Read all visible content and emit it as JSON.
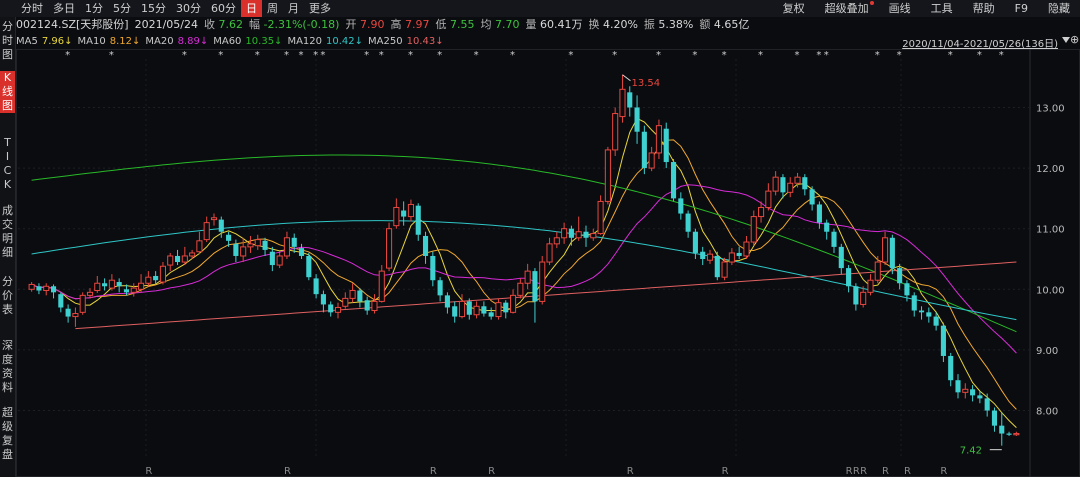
{
  "toolbar": {
    "periods": [
      "分时",
      "多日",
      "1分",
      "5分",
      "15分",
      "30分",
      "60分",
      "日",
      "周",
      "月",
      "更多"
    ],
    "active_period": "日",
    "tools": [
      "复权",
      "超级叠加",
      "画线",
      "工具",
      "帮助",
      "F9",
      "隐藏"
    ]
  },
  "quote": {
    "code": "002124.SZ[天邦股份]",
    "date": "2021/05/24",
    "close_label": "收",
    "close": "7.62",
    "change_label": "幅",
    "change": "-2.31%(-0.18)",
    "open_label": "开",
    "open": "7.90",
    "high_label": "高",
    "high": "7.97",
    "low_label": "低",
    "low": "7.55",
    "avg_label": "均",
    "avg": "7.70",
    "volume_label": "量",
    "volume": "60.41万",
    "turnover_label": "换",
    "turnover": "4.20%",
    "amplitude_label": "振",
    "amplitude": "5.38%",
    "amount_label": "额",
    "amount": "4.65亿"
  },
  "ma": [
    {
      "label": "MA5",
      "value": "7.96↓",
      "color": "#e7d53a"
    },
    {
      "label": "MA10",
      "value": "8.12↓",
      "color": "#f0a830"
    },
    {
      "label": "MA20",
      "value": "8.89↓",
      "color": "#d72bd7"
    },
    {
      "label": "MA60",
      "value": "10.35↓",
      "color": "#28b928"
    },
    {
      "label": "MA120",
      "value": "10.42↓",
      "color": "#2fc6c6"
    },
    {
      "label": "MA250",
      "value": "10.43↓",
      "color": "#e06060"
    }
  ],
  "range_text": "2020/11/04-2021/05/26(136日)",
  "sidebar": [
    {
      "name": "intraday",
      "chars": [
        "分",
        "时",
        "图"
      ],
      "active": false
    },
    {
      "name": "kline",
      "chars": [
        "K",
        "线",
        "图"
      ],
      "active": true
    },
    {
      "name": "tick",
      "chars": [
        "T",
        "I",
        "C",
        "K"
      ],
      "active": false
    },
    {
      "name": "trades",
      "chars": [
        "成",
        "交",
        "明",
        "细"
      ],
      "active": false
    },
    {
      "name": "price-table",
      "chars": [
        "分",
        "价",
        "表"
      ],
      "active": false
    },
    {
      "name": "depth",
      "chars": [
        "深",
        "度",
        "资",
        "料"
      ],
      "active": false
    },
    {
      "name": "super-review",
      "chars": [
        "超",
        "级",
        "复",
        "盘"
      ],
      "active": false
    }
  ],
  "chart_data": {
    "type": "candlestick",
    "ylim": [
      7.2,
      13.8
    ],
    "y_ticks": [
      8.0,
      9.0,
      10.0,
      11.0,
      12.0,
      13.0
    ],
    "y_tick_labels": [
      "8.00",
      "9.00",
      "10.00",
      "11.00",
      "12.00",
      "13.00"
    ],
    "up_color": "#e8473f",
    "down_color": "#3fd0d0",
    "annotations": {
      "high": "13.54",
      "low": "7.42"
    },
    "event_marker": "*",
    "rights_marker": "R",
    "candles": [
      [
        10.0,
        10.08,
        10.12,
        9.96
      ],
      [
        10.05,
        9.98,
        10.1,
        9.92
      ],
      [
        9.98,
        10.05,
        10.1,
        9.9
      ],
      [
        10.05,
        9.95,
        10.08,
        9.85
      ],
      [
        9.92,
        9.7,
        9.95,
        9.62
      ],
      [
        9.68,
        9.55,
        9.75,
        9.45
      ],
      [
        9.55,
        9.6,
        9.7,
        9.38
      ],
      [
        9.62,
        9.9,
        9.95,
        9.58
      ],
      [
        9.9,
        9.95,
        10.02,
        9.85
      ],
      [
        9.98,
        10.1,
        10.22,
        9.94
      ],
      [
        10.1,
        10.05,
        10.18,
        9.98
      ],
      [
        10.02,
        10.15,
        10.25,
        9.98
      ],
      [
        10.12,
        10.05,
        10.18,
        9.95
      ],
      [
        10.0,
        9.95,
        10.08,
        9.9
      ],
      [
        9.95,
        10.02,
        10.1,
        9.88
      ],
      [
        10.0,
        10.1,
        10.25,
        9.95
      ],
      [
        10.1,
        10.2,
        10.3,
        10.05
      ],
      [
        10.22,
        10.15,
        10.3,
        10.08
      ],
      [
        10.12,
        10.38,
        10.45,
        10.08
      ],
      [
        10.4,
        10.55,
        10.6,
        10.3
      ],
      [
        10.55,
        10.45,
        10.65,
        10.4
      ],
      [
        10.45,
        10.55,
        10.7,
        10.4
      ],
      [
        10.55,
        10.6,
        10.65,
        10.5
      ],
      [
        10.62,
        10.8,
        10.95,
        10.58
      ],
      [
        10.82,
        11.1,
        11.2,
        10.78
      ],
      [
        11.15,
        11.18,
        11.25,
        11.05
      ],
      [
        11.15,
        10.95,
        11.2,
        10.85
      ],
      [
        10.9,
        10.8,
        10.95,
        10.7
      ],
      [
        10.75,
        10.55,
        10.82,
        10.45
      ],
      [
        10.55,
        10.7,
        10.85,
        10.45
      ],
      [
        10.7,
        10.75,
        10.88,
        10.6
      ],
      [
        10.72,
        10.82,
        10.9,
        10.65
      ],
      [
        10.8,
        10.65,
        10.85,
        10.55
      ],
      [
        10.62,
        10.4,
        10.7,
        10.3
      ],
      [
        10.4,
        10.55,
        10.62,
        10.35
      ],
      [
        10.55,
        10.85,
        10.95,
        10.5
      ],
      [
        10.85,
        10.7,
        10.92,
        10.6
      ],
      [
        10.68,
        10.55,
        10.75,
        10.5
      ],
      [
        10.55,
        10.2,
        10.6,
        10.15
      ],
      [
        10.18,
        9.92,
        10.25,
        9.85
      ],
      [
        9.92,
        9.75,
        9.98,
        9.62
      ],
      [
        9.75,
        9.62,
        9.8,
        9.55
      ],
      [
        9.62,
        9.7,
        9.78,
        9.52
      ],
      [
        9.72,
        9.85,
        9.95,
        9.68
      ],
      [
        9.85,
        9.98,
        10.1,
        9.78
      ],
      [
        9.98,
        9.8,
        10.02,
        9.7
      ],
      [
        9.82,
        9.65,
        9.88,
        9.58
      ],
      [
        9.65,
        9.8,
        9.92,
        9.6
      ],
      [
        9.8,
        10.3,
        10.4,
        9.78
      ],
      [
        10.35,
        11.0,
        11.1,
        10.3
      ],
      [
        11.05,
        11.35,
        11.5,
        11.0
      ],
      [
        11.3,
        11.2,
        11.45,
        11.05
      ],
      [
        11.2,
        11.4,
        11.48,
        11.12
      ],
      [
        11.38,
        10.9,
        11.42,
        10.8
      ],
      [
        10.88,
        10.55,
        10.95,
        10.42
      ],
      [
        10.55,
        10.15,
        10.62,
        10.05
      ],
      [
        10.15,
        9.9,
        10.2,
        9.8
      ],
      [
        9.9,
        9.7,
        9.95,
        9.6
      ],
      [
        9.72,
        9.55,
        9.8,
        9.45
      ],
      [
        9.55,
        9.8,
        9.92,
        9.52
      ],
      [
        9.8,
        9.58,
        9.85,
        9.5
      ],
      [
        9.58,
        9.72,
        9.8,
        9.52
      ],
      [
        9.72,
        9.6,
        9.8,
        9.55
      ],
      [
        9.62,
        9.55,
        9.7,
        9.5
      ],
      [
        9.55,
        9.78,
        9.85,
        9.5
      ],
      [
        9.78,
        9.62,
        9.82,
        9.52
      ],
      [
        9.62,
        9.9,
        10.0,
        9.6
      ],
      [
        9.9,
        10.1,
        10.18,
        9.85
      ],
      [
        10.1,
        10.3,
        10.42,
        10.0
      ],
      [
        10.3,
        9.8,
        10.35,
        9.45
      ],
      [
        9.8,
        10.45,
        10.55,
        9.75
      ],
      [
        10.45,
        10.75,
        10.85,
        10.4
      ],
      [
        10.75,
        10.85,
        10.95,
        10.68
      ],
      [
        10.85,
        11.0,
        11.1,
        10.75
      ],
      [
        11.0,
        10.85,
        11.05,
        10.72
      ],
      [
        10.85,
        10.95,
        11.2,
        10.8
      ],
      [
        10.95,
        10.85,
        11.05,
        10.7
      ],
      [
        10.85,
        10.92,
        11.0,
        10.8
      ],
      [
        10.92,
        11.45,
        11.55,
        10.9
      ],
      [
        11.45,
        12.3,
        12.35,
        11.4
      ],
      [
        12.3,
        12.9,
        13.0,
        12.2
      ],
      [
        12.85,
        13.3,
        13.54,
        12.75
      ],
      [
        13.25,
        13.0,
        13.35,
        12.85
      ],
      [
        13.0,
        12.6,
        13.2,
        12.4
      ],
      [
        12.6,
        12.0,
        12.7,
        11.9
      ],
      [
        12.0,
        12.25,
        12.35,
        11.95
      ],
      [
        12.25,
        12.7,
        12.8,
        12.15
      ],
      [
        12.65,
        12.1,
        12.75,
        12.0
      ],
      [
        12.1,
        11.5,
        12.15,
        11.45
      ],
      [
        11.5,
        11.25,
        11.6,
        11.15
      ],
      [
        11.25,
        10.95,
        11.3,
        10.85
      ],
      [
        10.95,
        10.6,
        11.0,
        10.5
      ],
      [
        10.62,
        10.5,
        10.7,
        10.4
      ],
      [
        10.48,
        10.58,
        10.65,
        10.42
      ],
      [
        10.55,
        10.2,
        10.62,
        10.15
      ],
      [
        10.2,
        10.45,
        10.52,
        10.15
      ],
      [
        10.45,
        10.6,
        10.68,
        10.4
      ],
      [
        10.6,
        10.55,
        10.7,
        10.5
      ],
      [
        10.55,
        10.78,
        10.88,
        10.5
      ],
      [
        10.78,
        11.2,
        11.3,
        10.72
      ],
      [
        11.2,
        11.35,
        11.45,
        11.1
      ],
      [
        11.35,
        11.62,
        11.75,
        11.3
      ],
      [
        11.62,
        11.85,
        11.95,
        11.55
      ],
      [
        11.85,
        11.6,
        11.9,
        11.5
      ],
      [
        11.6,
        11.75,
        11.85,
        11.52
      ],
      [
        11.75,
        11.85,
        11.92,
        11.68
      ],
      [
        11.85,
        11.65,
        11.9,
        11.55
      ],
      [
        11.65,
        11.4,
        11.7,
        11.3
      ],
      [
        11.4,
        11.1,
        11.45,
        11.0
      ],
      [
        11.1,
        10.95,
        11.15,
        10.82
      ],
      [
        10.95,
        10.7,
        11.0,
        10.6
      ],
      [
        10.7,
        10.35,
        10.75,
        10.25
      ],
      [
        10.35,
        10.05,
        10.4,
        9.95
      ],
      [
        10.05,
        9.75,
        10.1,
        9.65
      ],
      [
        9.75,
        9.95,
        10.05,
        9.7
      ],
      [
        9.95,
        10.15,
        10.25,
        9.9
      ],
      [
        10.15,
        10.45,
        10.55,
        10.1
      ],
      [
        10.45,
        10.85,
        10.95,
        10.4
      ],
      [
        10.85,
        10.35,
        10.9,
        10.25
      ],
      [
        10.35,
        10.1,
        10.42,
        10.0
      ],
      [
        10.1,
        9.9,
        10.15,
        9.8
      ],
      [
        9.9,
        9.65,
        9.95,
        9.55
      ],
      [
        9.65,
        9.62,
        9.72,
        9.5
      ],
      [
        9.62,
        9.55,
        9.7,
        9.45
      ],
      [
        9.55,
        9.4,
        9.62,
        9.32
      ],
      [
        9.4,
        8.9,
        9.45,
        8.8
      ],
      [
        8.9,
        8.5,
        8.95,
        8.4
      ],
      [
        8.5,
        8.3,
        8.6,
        8.2
      ],
      [
        8.3,
        8.35,
        8.45,
        8.2
      ],
      [
        8.35,
        8.25,
        8.42,
        8.15
      ],
      [
        8.25,
        8.2,
        8.32,
        8.12
      ],
      [
        8.2,
        8.0,
        8.28,
        7.9
      ],
      [
        8.0,
        7.75,
        8.05,
        7.65
      ],
      [
        7.75,
        7.62,
        7.97,
        7.42
      ],
      [
        7.62,
        7.6,
        7.65,
        7.58
      ],
      [
        7.6,
        7.62,
        7.65,
        7.58
      ]
    ]
  }
}
